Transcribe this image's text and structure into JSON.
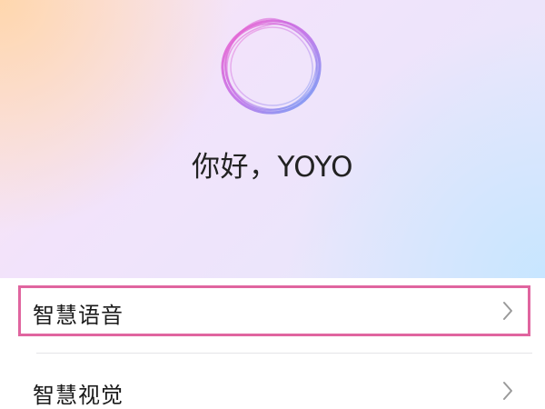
{
  "assistant": {
    "greeting": "你好，YOYO",
    "orb_icon": "voice-orb-icon",
    "colors": {
      "orb_pink": "#f065c8",
      "orb_blue": "#6f9cf5",
      "highlight": "#e0659f"
    }
  },
  "menu": {
    "items": [
      {
        "label": "智慧语音",
        "icon": "chevron-right-icon",
        "highlighted": true
      },
      {
        "label": "智慧视觉",
        "icon": "chevron-right-icon",
        "highlighted": false
      }
    ]
  }
}
